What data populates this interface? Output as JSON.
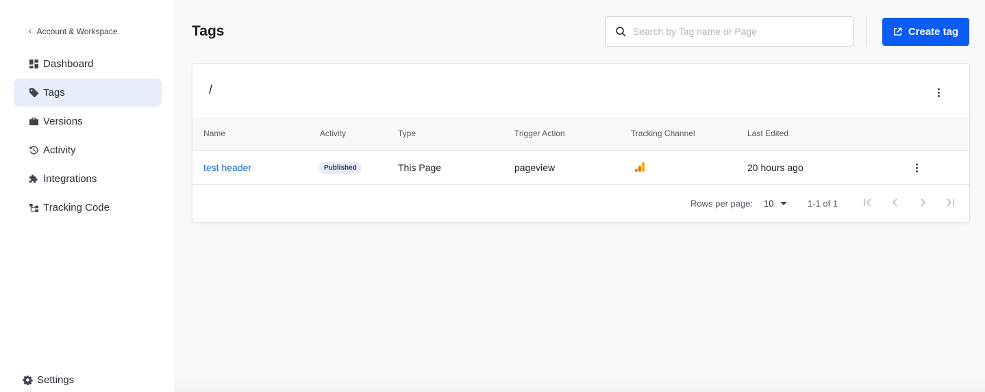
{
  "sidebar": {
    "back_label": "Account & Workspace",
    "items": [
      {
        "label": "Dashboard",
        "icon": "dashboard-icon"
      },
      {
        "label": "Tags",
        "icon": "tag-icon",
        "active": true
      },
      {
        "label": "Versions",
        "icon": "briefcase-icon"
      },
      {
        "label": "Activity",
        "icon": "history-icon"
      },
      {
        "label": "Integrations",
        "icon": "puzzle-icon"
      },
      {
        "label": "Tracking Code",
        "icon": "tracking-code-icon"
      }
    ],
    "settings_label": "Settings"
  },
  "header": {
    "title": "Tags",
    "search_placeholder": "Search by Tag name or Page",
    "search_value": "",
    "create_label": "Create tag"
  },
  "card": {
    "path": "/",
    "columns": [
      "Name",
      "Activity",
      "Type",
      "Trigger Action",
      "Tracking Channel",
      "Last Edited"
    ],
    "rows": [
      {
        "name": "test header",
        "activity": "Published",
        "type": "This Page",
        "trigger": "pageview",
        "channel_icon": "google-analytics-icon",
        "last_edited": "20 hours ago"
      }
    ],
    "pagination": {
      "rows_per_page_label": "Rows per page:",
      "rows_per_page": "10",
      "range": "1-1 of 1"
    }
  },
  "colors": {
    "accent": "#0a5cf5",
    "link": "#1a6ee0",
    "active_nav_bg": "#e8edfb",
    "badge_bg": "#e6ebf7",
    "ga_orange": "#f9ab00",
    "ga_dark_orange": "#e37400"
  }
}
